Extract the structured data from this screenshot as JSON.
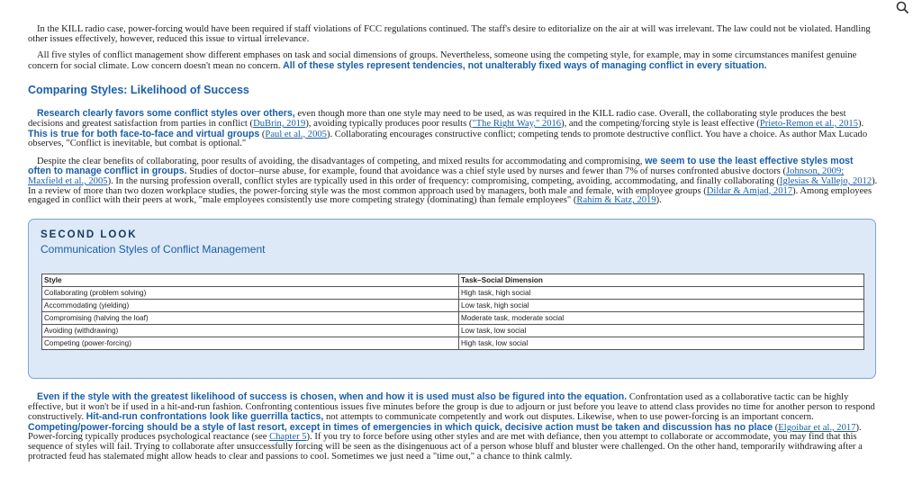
{
  "toolbar": {
    "search_icon": "search-icon"
  },
  "p1": "In the KILL radio case, power-forcing would have been required if staff violations of FCC regulations continued. The staff's desire to editorialize on the air at will was irrelevant. The law could not be violated. Handling other issues effectively, however, reduced this issue to virtual irrelevance.",
  "p2": {
    "text": "All five styles of conflict management show different emphases on task and social dimensions of groups. Nevertheless, someone using the competing style, for example, may in some circumstances manifest genuine concern for social climate. Low concern doesn't mean no concern.",
    "hl": "All of these styles represent tendencies, not unalterably fixed ways of managing conflict in every situation."
  },
  "heading": "Comparing Styles: Likelihood of Success",
  "p3": {
    "hl1": "Research clearly favors some conflict styles over others,",
    "t1": "even though more than one style may need to be used, as was required in the KILL radio case. Overall, the collaborating style produces the best decisions and greatest satisfaction from parties in conflict (",
    "l1": "DuBrin, 2019",
    "t2": "), avoiding typically produces poor results (",
    "l2": "\"The Right Way,\" 2016",
    "t3": "), and the competing/forcing style is least effective (",
    "l3": "Prieto-Remon et al., 2015",
    "t4": ").",
    "hl2": "This is true for both face-to-face and virtual groups",
    "t5": "(",
    "l4": "Paul et al., 2005",
    "t6": "). Collaborating encourages constructive conflict; competing tends to promote destructive conflict. You have a choice. As author Max Lucado observes, \"Conflict is inevitable, but combat is optional.\""
  },
  "p4": {
    "t1": "Despite the clear benefits of collaborating, poor results of avoiding, the disadvantages of competing, and mixed results for accommodating and compromising,",
    "hl1": "we seem to use the least effective styles most often to manage conflict in groups.",
    "t2": "Studies of doctor–nurse abuse, for example, found that avoidance was a chief style used by nurses and fewer than 7% of nurses confronted abusive doctors (",
    "l1": "Johnson, 2009; Maxfield et al., 2005",
    "t3": "). In the nursing profession overall, conflict styles are typically used in this order of frequency: compromising, competing, avoiding, accommodating, and finally collaborating (",
    "l2": "Iglesias & Vallejo, 2012",
    "t4": "). In a review of more than two dozen workplace studies, the power-forcing style was the most common approach used by managers, both male and female, with employee groups (",
    "l3": "Dildar & Amjad, 2017",
    "t5": "). Among employees engaged in conflict with their peers at work, \"male employees consistently use more competing strategy (dominating) than female employees\" (",
    "l4": "Rahim & Katz, 2019",
    "t6": ")."
  },
  "box": {
    "kicker": "SECOND LOOK",
    "title": "Communication Styles of Conflict Management",
    "headers": [
      "Style",
      "Task–Social Dimension"
    ],
    "rows": [
      [
        "Collaborating (problem solving)",
        "High task, high social"
      ],
      [
        "Accommodating (yielding)",
        "Low task, high social"
      ],
      [
        "Compromising (halving the loaf)",
        "Moderate task, moderate social"
      ],
      [
        "Avoiding (withdrawing)",
        "Low task, low social"
      ],
      [
        "Competing (power-forcing)",
        "High task, low social"
      ]
    ]
  },
  "p5": {
    "hl1": "Even if the style with the greatest likelihood of success is chosen, when and how it is used must also be figured into the equation.",
    "t1": "Confrontation used as a collaborative tactic can be highly effective, but it won't be if used in a hit-and-run fashion. Confronting contentious issues five minutes before the group is due to adjourn or just before you leave to attend class provides no time for another person to respond constructively.",
    "hl2": "Hit-and-run confrontations look like guerrilla tactics,",
    "t2": "not attempts to communicate competently and work out disputes. Likewise, when to use power-forcing is an important concern.",
    "hl3": "Competing/power-forcing should be a style of last resort, except in times of emergencies in which quick, decisive action must be taken and discussion has no place",
    "t3": "(",
    "l1": "Elgoibar et al., 2017",
    "t4": "). Power-forcing typically produces psychological reactance (see",
    "l2": "Chapter 5",
    "t5": "). If you try to force before using other styles and are met with defiance, then you attempt to collaborate or accommodate, you may find that this sequence of styles will fail. Trying to collaborate after unsuccessfully forcing will be seen as the disingenuous act of a person whose bluff and bluster were challenged. On the other hand, temporarily withdrawing after a protracted feud has stalemated might allow heads to clear and passions to cool. Sometimes we just need a \"time out,\" a chance to think calmly."
  }
}
